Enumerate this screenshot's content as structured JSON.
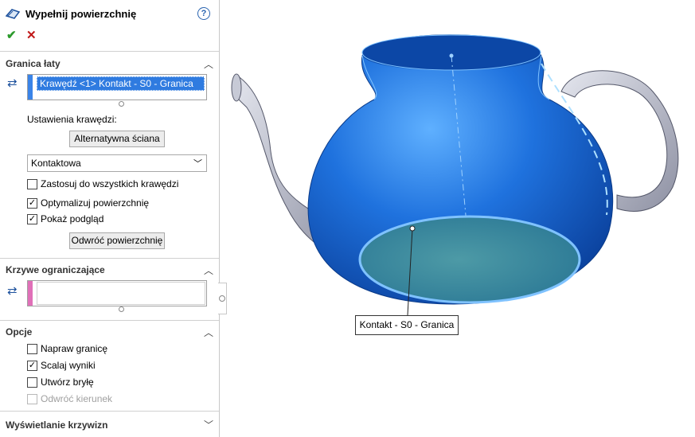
{
  "panel": {
    "title": "Wypełnij powierzchnię",
    "help_icon": "?",
    "ok_icon": "✔",
    "cancel_icon": "✕"
  },
  "patch_boundary": {
    "header": "Granica łaty",
    "selected_item": "Krawędź <1> Kontakt - S0 - Granica",
    "edge_settings_label": "Ustawienia krawędzi:",
    "alt_face_button": "Alternatywna ściana",
    "contact_select": "Kontaktowa",
    "apply_all_edges": {
      "label": "Zastosuj do wszystkich krawędzi",
      "checked": false
    },
    "optimize_surface": {
      "label": "Optymalizuj powierzchnię",
      "checked": true
    },
    "show_preview": {
      "label": "Pokaż podgląd",
      "checked": true
    },
    "reverse_surface_button": "Odwróć powierzchnię"
  },
  "constraint_curves": {
    "header": "Krzywe ograniczające"
  },
  "options": {
    "header": "Opcje",
    "fix_boundary": {
      "label": "Napraw granicę",
      "checked": false
    },
    "merge_result": {
      "label": "Scalaj wyniki",
      "checked": true
    },
    "create_solid": {
      "label": "Utwórz bryłę",
      "checked": false
    },
    "reverse_direction": {
      "label": "Odwróć kierunek",
      "checked": false,
      "disabled": true
    }
  },
  "curvature_display": {
    "header": "Wyświetlanie krzywizn"
  },
  "viewport": {
    "callout": "Kontakt - S0 - Granica",
    "colors": {
      "body": "#1f6fd6",
      "handle": "#b9bccb",
      "patch": "#3f8f9c",
      "edge": "#7fc2ff"
    }
  }
}
